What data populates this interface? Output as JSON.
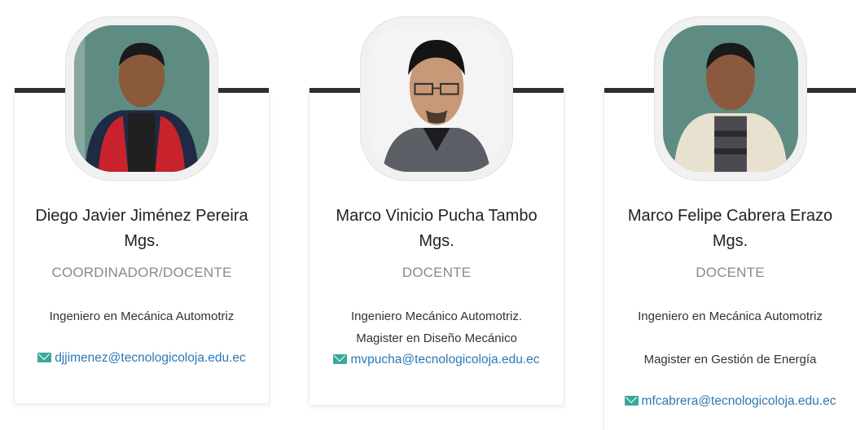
{
  "staff": [
    {
      "name_line1": "Diego Javier Jiménez Pereira",
      "name_line2": "Mgs.",
      "role": "COORDINADOR/DOCENTE",
      "info": [
        "Ingeniero en Mecánica Automotriz"
      ],
      "email": "djjimenez@tecnologicoloja.edu.ec",
      "icon": "envelope-icon"
    },
    {
      "name_line1": "Marco Vinicio Pucha Tambo",
      "name_line2": "Mgs.",
      "role": "DOCENTE",
      "info": [
        "Ingeniero Mecánico Automotriz.",
        "Magister en Diseño Mecánico"
      ],
      "email": "mvpucha@tecnologicoloja.edu.ec",
      "icon": "envelope-icon"
    },
    {
      "name_line1": "Marco Felipe Cabrera Erazo",
      "name_line2": "Mgs.",
      "role": "DOCENTE",
      "info": [
        "Ingeniero en Mecánica Automotriz",
        "Magister en Gestión de Energía"
      ],
      "email": "mfcabrera@tecnologicoloja.edu.ec",
      "icon": "envelope-icon"
    }
  ],
  "colors": {
    "accent_bar": "#2f2f2f",
    "link": "#2b78b5",
    "icon": "#3aa89b",
    "role": "#8a8a8a"
  }
}
